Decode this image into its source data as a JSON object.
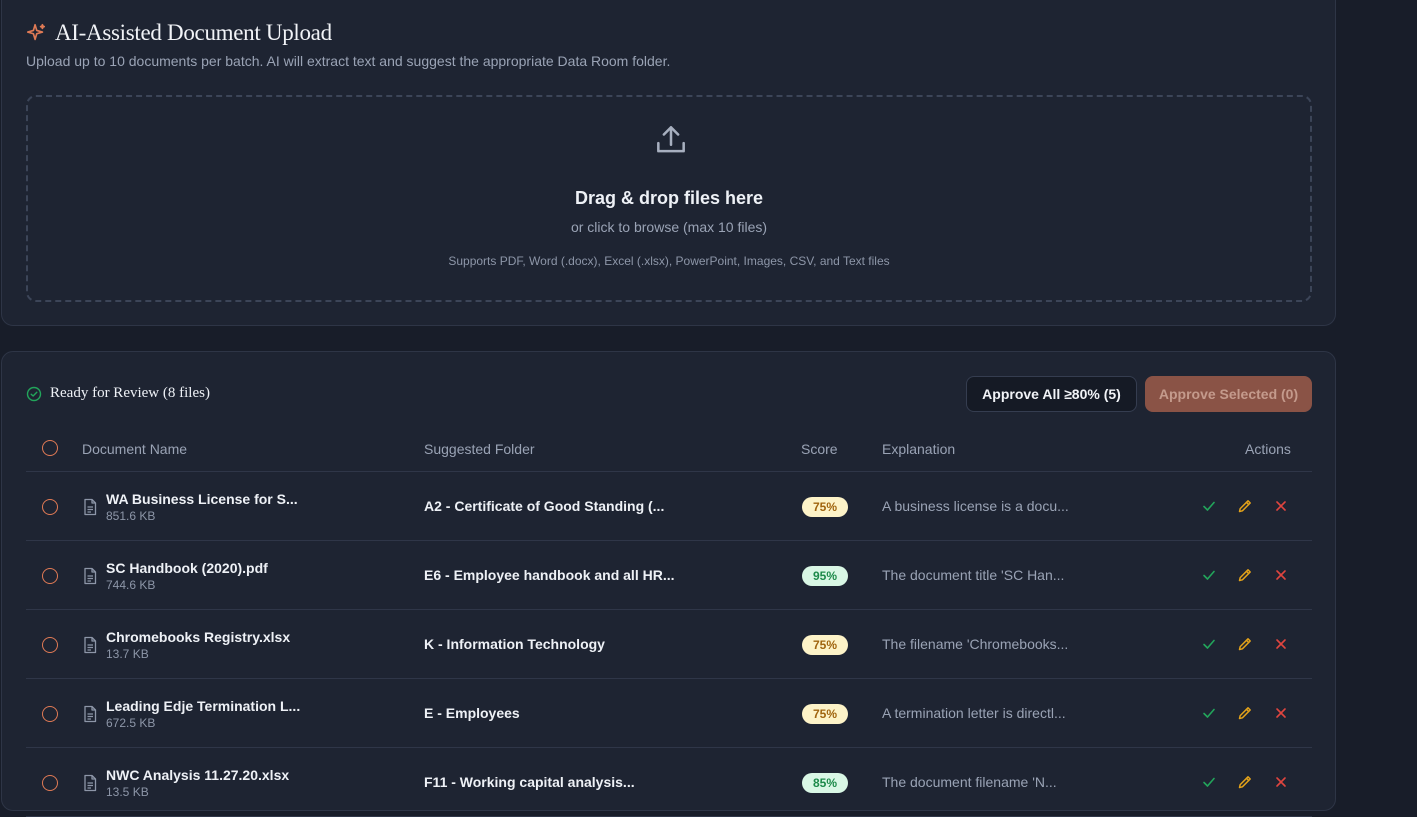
{
  "upload": {
    "title": "AI-Assisted Document Upload",
    "subtitle": "Upload up to 10 documents per batch. AI will extract text and suggest the appropriate Data Room folder.",
    "dropzone": {
      "title": "Drag & drop files here",
      "subtitle": "or click to browse (max 10 files)",
      "supported": "Supports PDF, Word (.docx), Excel (.xlsx), PowerPoint, Images, CSV, and Text files"
    }
  },
  "review": {
    "title": "Ready for Review (8 files)",
    "approve_all_label": "Approve All ≥80% (5)",
    "approve_selected_label": "Approve Selected (0)",
    "columns": {
      "name": "Document Name",
      "folder": "Suggested Folder",
      "score": "Score",
      "explanation": "Explanation",
      "actions": "Actions"
    },
    "rows": [
      {
        "name": "WA Business License for S...",
        "size": "851.6 KB",
        "folder": "A2 - Certificate of Good Standing (...",
        "score": "75%",
        "explanation": "A business license is a docu..."
      },
      {
        "name": "SC Handbook (2020).pdf",
        "size": "744.6 KB",
        "folder": "E6 - Employee handbook and all HR...",
        "score": "95%",
        "explanation": "The document title 'SC Han..."
      },
      {
        "name": "Chromebooks Registry.xlsx",
        "size": "13.7 KB",
        "folder": "K - Information Technology",
        "score": "75%",
        "explanation": "The filename 'Chromebooks..."
      },
      {
        "name": "Leading Edje Termination L...",
        "size": "672.5 KB",
        "folder": "E - Employees",
        "score": "75%",
        "explanation": "A termination letter is directl..."
      },
      {
        "name": "NWC Analysis 11.27.20.xlsx",
        "size": "13.5 KB",
        "folder": "F11 - Working capital analysis...",
        "score": "85%",
        "explanation": "The document filename 'N..."
      }
    ]
  },
  "colors": {
    "accent": "#e07a55",
    "approve": "#22a55b",
    "edit": "#e3a21a",
    "reject": "#e0453f",
    "score_mid_bg": "#fdf3c8",
    "score_high_bg": "#d9f7e5"
  },
  "icons": {
    "title": "sparkle-icon",
    "dropzone": "upload-icon",
    "review": "check-circle-icon",
    "document": "document-icon",
    "approve": "check-icon",
    "edit": "pencil-icon",
    "reject": "close-icon"
  }
}
